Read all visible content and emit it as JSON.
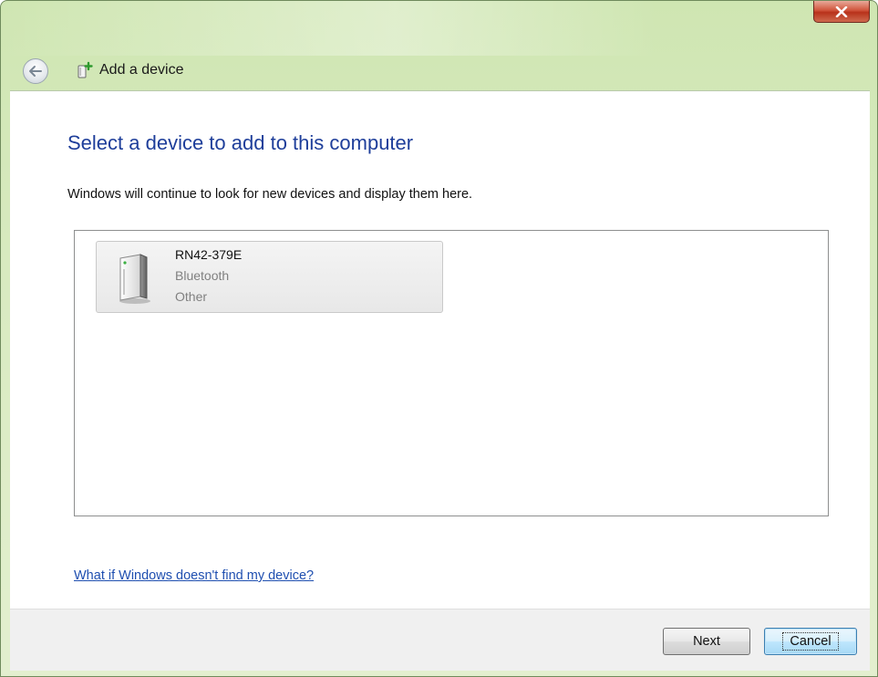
{
  "window": {
    "title": "Add a device"
  },
  "page": {
    "heading": "Select a device to add to this computer",
    "info": "Windows will continue to look for new devices and display them here.",
    "help_link": "What if Windows doesn't find my device?"
  },
  "devices": [
    {
      "name": "RN42-379E",
      "type": "Bluetooth",
      "category": "Other",
      "icon": "bluetooth-device-icon"
    }
  ],
  "buttons": {
    "next": "Next",
    "cancel": "Cancel"
  },
  "colors": {
    "heading": "#1e3e9a",
    "link": "#1f4fb0",
    "titlebar": "#cfe6b2",
    "close": "#c7432b"
  }
}
